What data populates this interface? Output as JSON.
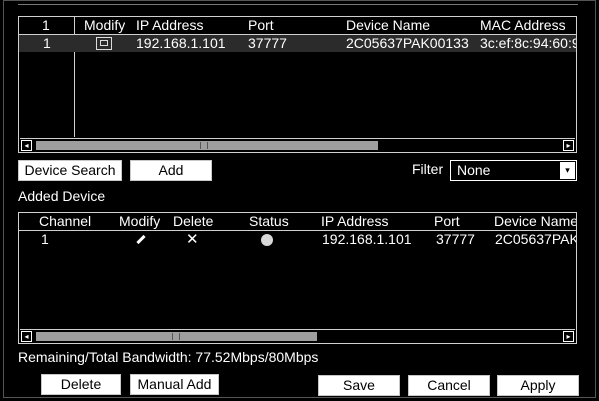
{
  "search_table": {
    "columns": [
      "1",
      "Modify",
      "IP Address",
      "Port",
      "Device Name",
      "MAC Address"
    ],
    "rows": [
      {
        "index": "1",
        "ip": "192.168.1.101",
        "port": "37777",
        "name": "2C05637PAK00133",
        "mac": "3c:ef:8c:94:60:9"
      }
    ]
  },
  "buttons": {
    "device_search": "Device Search",
    "add": "Add",
    "delete": "Delete",
    "manual_add": "Manual Add",
    "save": "Save",
    "cancel": "Cancel",
    "apply": "Apply"
  },
  "filter": {
    "label": "Filter",
    "value": "None"
  },
  "added_device": {
    "title": "Added Device",
    "columns": [
      "Channel",
      "Modify",
      "Delete",
      "Status",
      "IP Address",
      "Port",
      "Device Name"
    ],
    "rows": [
      {
        "channel": "1",
        "ip": "192.168.1.101",
        "port": "37777",
        "name": "2C05637PAK"
      }
    ]
  },
  "bandwidth": "Remaining/Total Bandwidth: 77.52Mbps/80Mbps",
  "icons": {
    "arrow_left": "◂",
    "arrow_right": "▸",
    "arrow_down": "▾"
  }
}
